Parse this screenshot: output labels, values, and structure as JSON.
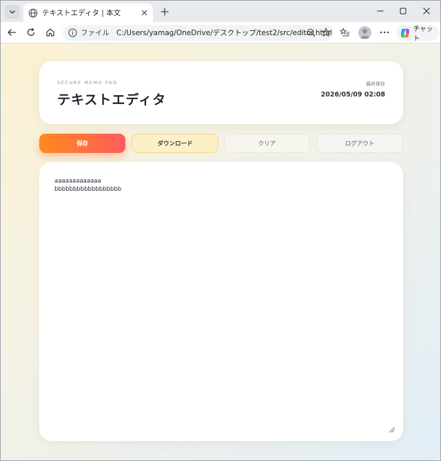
{
  "browser": {
    "tab_title": "テキストエディタ | 本文",
    "address_scheme": "ファイル",
    "address_url": "C:/Users/yamag/OneDrive/デスクトップ/test2/src/editor.html",
    "copilot_label": "チャット"
  },
  "header": {
    "eyebrow": "SECURE MEMO PAD",
    "title": "テキストエディタ",
    "last_saved_label": "最終保存",
    "last_saved_time": "2026/05/09 02:08"
  },
  "actions": {
    "save": "保存",
    "download": "ダウンロード",
    "clear": "クリア",
    "logout": "ログアウト"
  },
  "editor": {
    "content": "aaaaaaaaaaaaa\nbbbbbbbbbbbbbbbbbb"
  },
  "colors": {
    "save_gradient_start": "#ff8a1e",
    "save_gradient_end": "#ff5c5c",
    "download_bg": "#fdf0c8"
  }
}
